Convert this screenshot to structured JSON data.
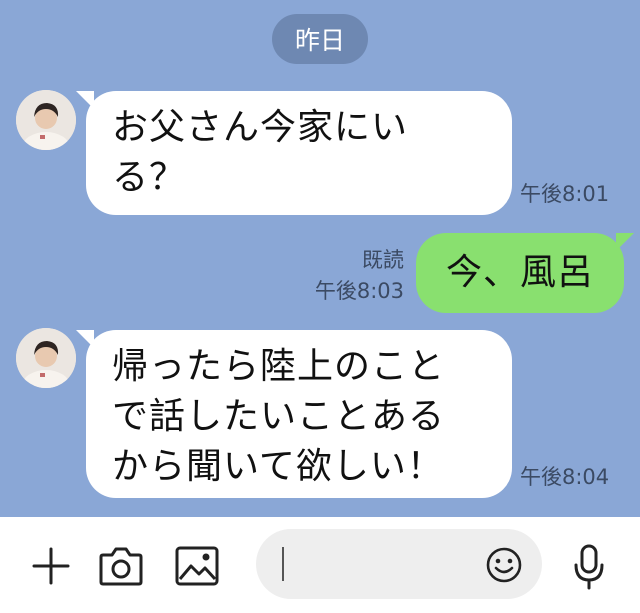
{
  "date_separator": "昨日",
  "messages": [
    {
      "direction": "in",
      "text_lines": [
        "お父さん今家にい",
        "る？"
      ],
      "time": "午後8:01"
    },
    {
      "direction": "out",
      "text": "今、風呂",
      "read_label": "既読",
      "time": "午後8:03"
    },
    {
      "direction": "in",
      "text_lines": [
        "帰ったら陸上のこと",
        "で話したいことある",
        "から聞いて欲しい！"
      ],
      "time": "午後8:04"
    }
  ],
  "composer": {
    "input_value": "",
    "icons": [
      "plus-icon",
      "camera-icon",
      "image-icon",
      "emoji-icon",
      "microphone-icon"
    ]
  },
  "colors": {
    "chat_background": "#8aa7d6",
    "outgoing_bubble": "#89e06f",
    "incoming_bubble": "#ffffff"
  }
}
